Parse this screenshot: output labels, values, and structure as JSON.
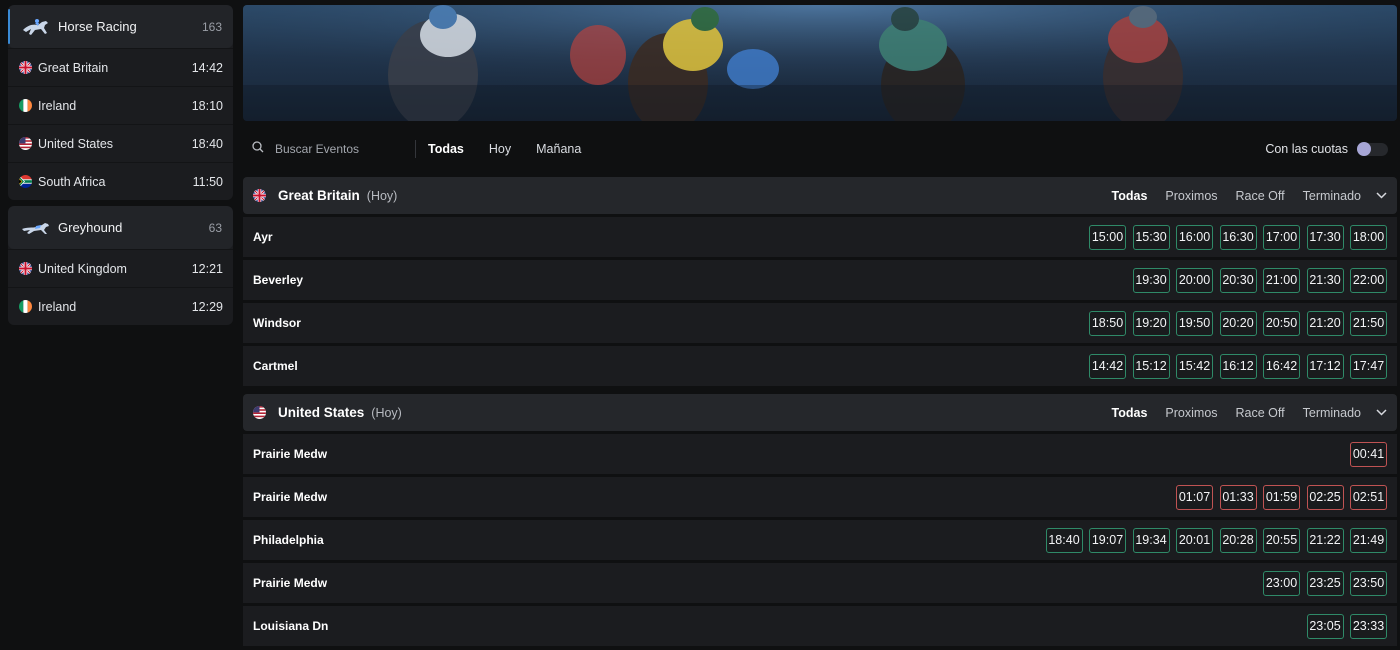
{
  "sidebar": {
    "groups": [
      {
        "name": "Horse Racing",
        "count": "163",
        "icon": "horse-racing-icon",
        "regions": [
          {
            "name": "Great Britain",
            "time": "14:42",
            "flag": "gb"
          },
          {
            "name": "Ireland",
            "time": "18:10",
            "flag": "ie"
          },
          {
            "name": "United States",
            "time": "18:40",
            "flag": "us"
          },
          {
            "name": "South Africa",
            "time": "11:50",
            "flag": "za"
          }
        ]
      },
      {
        "name": "Greyhound",
        "count": "63",
        "icon": "greyhound-icon",
        "regions": [
          {
            "name": "United Kingdom",
            "time": "12:21",
            "flag": "gb"
          },
          {
            "name": "Ireland",
            "time": "12:29",
            "flag": "ie"
          }
        ]
      }
    ]
  },
  "filters": {
    "search_placeholder": "Buscar Eventos",
    "tabs": [
      "Todas",
      "Hoy",
      "Mañana"
    ],
    "odds_toggle_label": "Con las cuotas"
  },
  "sections": [
    {
      "title": "Great Britain",
      "when": "(Hoy)",
      "flag": "gb",
      "tabs": [
        "Todas",
        "Proximos",
        "Race Off",
        "Terminado"
      ],
      "meetings": [
        {
          "track": "Ayr",
          "times": [
            "15:00",
            "15:30",
            "16:00",
            "16:30",
            "17:00",
            "17:30",
            "18:00"
          ],
          "late": []
        },
        {
          "track": "Beverley",
          "times": [
            "19:30",
            "20:00",
            "20:30",
            "21:00",
            "21:30",
            "22:00"
          ],
          "late": []
        },
        {
          "track": "Windsor",
          "times": [
            "18:50",
            "19:20",
            "19:50",
            "20:20",
            "20:50",
            "21:20",
            "21:50"
          ],
          "late": []
        },
        {
          "track": "Cartmel",
          "times": [
            "14:42",
            "15:12",
            "15:42",
            "16:12",
            "16:42",
            "17:12",
            "17:47"
          ],
          "late": []
        }
      ]
    },
    {
      "title": "United States",
      "when": "(Hoy)",
      "flag": "us",
      "tabs": [
        "Todas",
        "Proximos",
        "Race Off",
        "Terminado"
      ],
      "meetings": [
        {
          "track": "Prairie Medw",
          "times": [
            "00:41"
          ],
          "late": [
            "00:41"
          ]
        },
        {
          "track": "Prairie Medw",
          "times": [
            "01:07",
            "01:33",
            "01:59",
            "02:25",
            "02:51"
          ],
          "late": [
            "01:07",
            "01:33",
            "01:59",
            "02:25",
            "02:51"
          ]
        },
        {
          "track": "Philadelphia",
          "times": [
            "18:40",
            "19:07",
            "19:34",
            "20:01",
            "20:28",
            "20:55",
            "21:22",
            "21:49"
          ],
          "late": []
        },
        {
          "track": "Prairie Medw",
          "times": [
            "23:00",
            "23:25",
            "23:50"
          ],
          "late": []
        },
        {
          "track": "Louisiana Dn",
          "times": [
            "23:05",
            "23:33"
          ],
          "late": []
        }
      ]
    }
  ],
  "colors": {
    "accent_green": "#2f8a68",
    "accent_red": "#c05353",
    "toggle_knob": "#a7a6d6"
  }
}
